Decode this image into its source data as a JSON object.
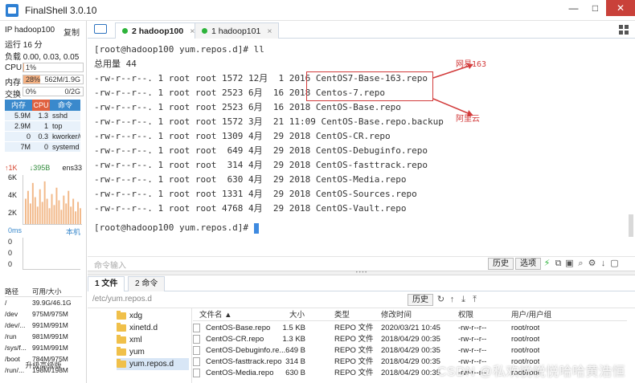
{
  "window": {
    "title": "FinalShell 3.0.10",
    "min": "—",
    "max": "□",
    "close": "✕"
  },
  "sidebar": {
    "host": "IP hadoop100",
    "copy": "复制",
    "uptime": "运行 16 分",
    "load": "负载 0.00, 0.03, 0.05",
    "cpu": {
      "label": "CPU",
      "value": "1%",
      "fraction": 0.01
    },
    "mem": {
      "label": "内存",
      "value": "28%",
      "detail": "562M/1.9G",
      "fraction": 0.28
    },
    "swap": {
      "label": "交换",
      "value": "0%",
      "detail": "0/2G",
      "fraction": 0.0
    },
    "proc_headers": [
      "内存",
      "CPU",
      "命令"
    ],
    "processes": [
      {
        "mem": "5.9M",
        "cpu": "1.3",
        "cmd": "sshd"
      },
      {
        "mem": "2.9M",
        "cpu": "1",
        "cmd": "top"
      },
      {
        "mem": "0",
        "cpu": "0.3",
        "cmd": "kworker/0"
      },
      {
        "mem": "7M",
        "cpu": "0",
        "cmd": "systemd"
      }
    ],
    "net": {
      "up": "↑1K",
      "down": "↓395B",
      "iface": "ens33",
      "ticks": [
        "6K",
        "4K",
        "2K"
      ]
    },
    "ping": {
      "label": "0ms",
      "host": "本机",
      "ticks": [
        "0",
        "0",
        "0"
      ]
    },
    "disk_headers": [
      "路径",
      "可用/大小"
    ],
    "disks": [
      {
        "path": "/",
        "size": "39.9G/46.1G"
      },
      {
        "path": "/dev",
        "size": "975M/975M"
      },
      {
        "path": "/dev/...",
        "size": "991M/991M"
      },
      {
        "path": "/run",
        "size": "981M/991M"
      },
      {
        "path": "/sys/f...",
        "size": "991M/991M"
      },
      {
        "path": "/boot",
        "size": "784M/975M"
      },
      {
        "path": "/run/...",
        "size": "198M/198M"
      }
    ],
    "upgrade": "升级高级版"
  },
  "tabs": [
    {
      "label": "2 hadoop100",
      "active": true,
      "close": "×"
    },
    {
      "label": "1 hadoop101",
      "active": false,
      "close": "×"
    }
  ],
  "terminal": {
    "lines": [
      "[root@hadoop100 yum.repos.d]# ll",
      "总用量 44",
      "-rw-r--r--. 1 root root 1572 12月  1 2016 CentOS7-Base-163.repo",
      "-rw-r--r--. 1 root root 2523 6月  16 2018 Centos-7.repo",
      "-rw-r--r--. 1 root root 2523 6月  16 2018 CentOS-Base.repo",
      "-rw-r--r--. 1 root root 1572 3月  21 11:09 CentOS-Base.repo.backup",
      "-rw-r--r--. 1 root root 1309 4月  29 2018 CentOS-CR.repo",
      "-rw-r--r--. 1 root root  649 4月  29 2018 CentOS-Debuginfo.repo",
      "-rw-r--r--. 1 root root  314 4月  29 2018 CentOS-fasttrack.repo",
      "-rw-r--r--. 1 root root  630 4月  29 2018 CentOS-Media.repo",
      "-rw-r--r--. 1 root root 1331 4月  29 2018 CentOS-Sources.repo",
      "-rw-r--r--. 1 root root 4768 4月  29 2018 CentOS-Vault.repo"
    ],
    "prompt": "[root@hadoop100 yum.repos.d]# ",
    "annotations": {
      "top": "网易163",
      "bottom": "阿里云"
    }
  },
  "cmdbar": {
    "placeholder": "命令输入",
    "history": "历史",
    "options": "选项"
  },
  "file_tabs": [
    {
      "label": "1 文件",
      "active": true
    },
    {
      "label": "2 命令",
      "active": false
    }
  ],
  "path": {
    "value": "/etc/yum.repos.d",
    "history": "历史"
  },
  "tree": [
    {
      "name": "xdg",
      "selected": false
    },
    {
      "name": "xinetd.d",
      "selected": false
    },
    {
      "name": "xml",
      "selected": false
    },
    {
      "name": "yum",
      "selected": false
    },
    {
      "name": "yum.repos.d",
      "selected": true
    }
  ],
  "file_headers": {
    "name": "文件名 ▲",
    "size": "大小",
    "type": "类型",
    "mtime": "修改时间",
    "perm": "权限",
    "owner": "用户/用户组"
  },
  "files": [
    {
      "name": "CentOS-Base.repo",
      "size": "1.5 KB",
      "type": "REPO 文件",
      "mtime": "2020/03/21 10:45",
      "perm": "-rw-r--r--",
      "owner": "root/root"
    },
    {
      "name": "CentOS-CR.repo",
      "size": "1.3 KB",
      "type": "REPO 文件",
      "mtime": "2018/04/29 00:35",
      "perm": "-rw-r--r--",
      "owner": "root/root"
    },
    {
      "name": "CentOS-Debuginfo.re...",
      "size": "649 B",
      "type": "REPO 文件",
      "mtime": "2018/04/29 00:35",
      "perm": "-rw-r--r--",
      "owner": "root/root"
    },
    {
      "name": "CentOS-fasttrack.repo",
      "size": "314 B",
      "type": "REPO 文件",
      "mtime": "2018/04/29 00:35",
      "perm": "-rw-r--r--",
      "owner": "root/root"
    },
    {
      "name": "CentOS-Media.repo",
      "size": "630 B",
      "type": "REPO 文件",
      "mtime": "2018/04/29 00:35",
      "perm": "-rw-r--r--",
      "owner": "root/root"
    }
  ],
  "watermark": "CSDN @私欢悦悦悦哈哈黄浩恒"
}
